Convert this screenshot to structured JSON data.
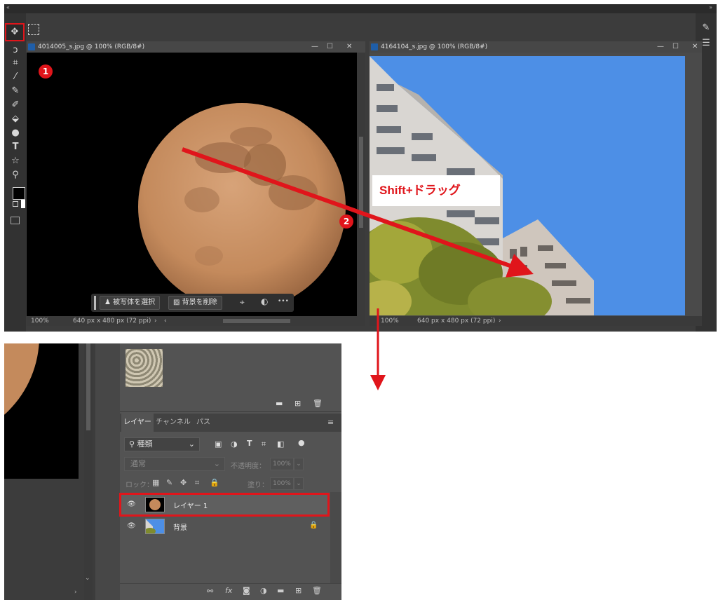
{
  "doc1": {
    "title": "4014005_s.jpg @ 100% (RGB/8#)",
    "zoom": "100%",
    "size": "640 px x 480 px (72 ppi)"
  },
  "doc2": {
    "title": "4164104_s.jpg @ 100% (RGB/8#)",
    "zoom": "100%",
    "size": "640 px x 480 px (72 ppi)"
  },
  "contextbar": {
    "select_subject": "被写体を選択",
    "remove_bg": "背景を削除",
    "more": "•••"
  },
  "annotations": {
    "step1": "1",
    "step2": "2",
    "drag_label": "Shift+ドラッグ"
  },
  "window_controls": {
    "minimize": "—",
    "maximize": "☐",
    "close": "✕"
  },
  "layers_panel": {
    "tabs": [
      "レイヤー",
      "チャンネル",
      "パス"
    ],
    "filter_kind": "種類",
    "blend_mode": "通常",
    "opacity_label": "不透明度：",
    "opacity_value": "100%",
    "lock_label": "ロック：",
    "fill_label": "塗り：",
    "fill_value": "100%",
    "layers": [
      {
        "name": "レイヤー 1",
        "selected": true
      },
      {
        "name": "背景",
        "locked": true
      }
    ]
  },
  "colors": {
    "accent_red": "#e0151b",
    "sky_blue": "#4d8fe6",
    "moon": "#c48a5c"
  }
}
